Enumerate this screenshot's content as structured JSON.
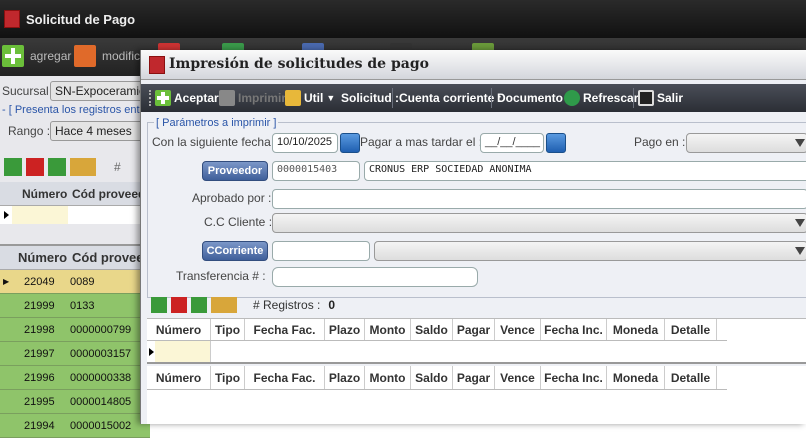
{
  "main": {
    "title": "Solicitud de Pago",
    "toolbar": {
      "add_label": "agregar",
      "edit_label": "modific"
    },
    "sucursal_label": "Sucursal :",
    "sucursal_value": "SN-Expoceramic",
    "present_text": "- [ Presenta los registros entr",
    "rango_label": "Rango :",
    "rango_value": "Hace 4 meses",
    "hint_partial": "#",
    "top_grid": {
      "col_numero": "Número",
      "col_prov": "Cód proveed"
    },
    "bottom_grid": {
      "col_numero": "Número",
      "col_prov": "Cód provee",
      "rows": [
        {
          "numero": "22049",
          "prov": "0089"
        },
        {
          "numero": "21999",
          "prov": "0133"
        },
        {
          "numero": "21998",
          "prov": "0000000799"
        },
        {
          "numero": "21997",
          "prov": "0000003157"
        },
        {
          "numero": "21996",
          "prov": "0000000338"
        },
        {
          "numero": "21995",
          "prov": "0000014805"
        },
        {
          "numero": "21994",
          "prov": "0000015002"
        }
      ]
    }
  },
  "dialog": {
    "title": "Impresión de solicitudes de pago",
    "toolbar": {
      "aceptar": "Aceptar",
      "imprimir": "Imprimir",
      "util": "Util",
      "solicitud": "Solicitud :",
      "cuenta": "Cuenta corriente :",
      "documento": "Documento :",
      "refrescar": "Refrescar",
      "salir": "Salir"
    },
    "params": {
      "legend": "[ Parámetros a imprimir ]",
      "fecha_label": "Con la siguiente fecha :",
      "fecha_value": "10/10/2025",
      "tardar_label": "Pagar a mas tardar el :",
      "tardar_value": "__/__/____",
      "pago_label": "Pago en :",
      "proveedor_btn": "Proveedor",
      "proveedor_code": "0000015403",
      "proveedor_name": "CRONUS ERP SOCIEDAD ANONIMA",
      "aprobado_label": "Aprobado por :",
      "cc_label": "C.C Cliente :",
      "ccorriente_btn": "CCorriente",
      "transfer_label": "Transferencia # :"
    },
    "registros_label": "# Registros :",
    "registros_count": "0",
    "columns": [
      "Número",
      "Tipo",
      "Fecha Fac.",
      "Plazo",
      "Monto",
      "Saldo",
      "Pagar",
      "Vence",
      "Fecha Inc.",
      "Moneda",
      "Detalle"
    ]
  },
  "colors": {
    "accent_blue": "#3f5f9a",
    "row_green": "#8fc46a",
    "row_selected": "#e9d78a"
  }
}
